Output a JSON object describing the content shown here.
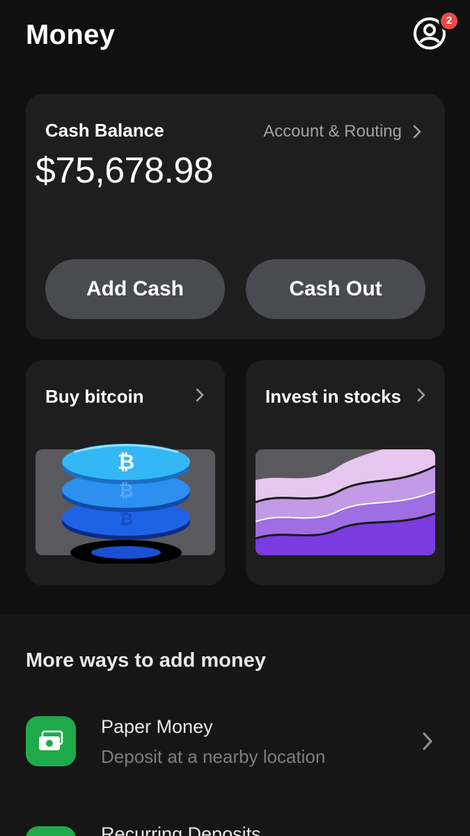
{
  "header": {
    "title": "Money",
    "profile_badge_count": "2"
  },
  "balance_card": {
    "label": "Cash Balance",
    "amount": "$75,678.98",
    "routing_link": "Account & Routing",
    "add_cash_label": "Add Cash",
    "cash_out_label": "Cash Out"
  },
  "tiles": {
    "bitcoin": {
      "label": "Buy bitcoin",
      "icon": "bitcoin-stack-illustration"
    },
    "stocks": {
      "label": "Invest in stocks",
      "icon": "stocks-wave-illustration"
    }
  },
  "more_ways": {
    "heading": "More ways to add money",
    "items": [
      {
        "title": "Paper Money",
        "subtitle": "Deposit at a nearby location",
        "icon": "cash-bill-icon"
      },
      {
        "title": "Recurring Deposits",
        "icon": "recurring-icon"
      }
    ]
  },
  "colors": {
    "background": "#101010",
    "card": "#1e1e1f",
    "pill_button": "#4a4b4e",
    "badge": "#e94b4b",
    "green_icon": "#1faa4b",
    "muted_text": "#a2a2a7"
  }
}
